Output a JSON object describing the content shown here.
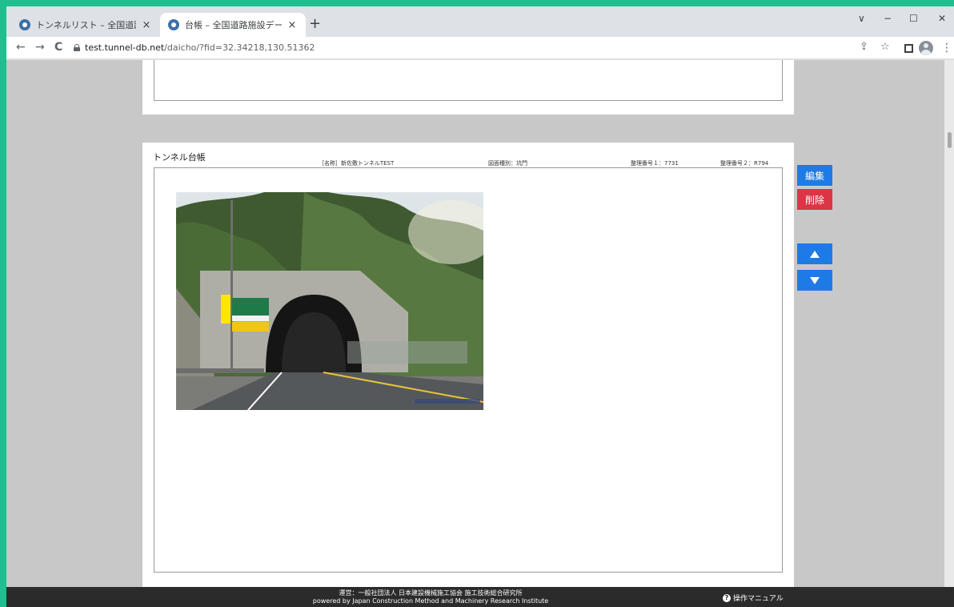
{
  "browser": {
    "tabs": [
      {
        "title": "トンネルリスト – 全国道路施設データ",
        "close": "×"
      },
      {
        "title": "台帳 – 全国道路施設データベース",
        "close": "×"
      }
    ],
    "new_tab": "+",
    "window_controls": {
      "dropdown": "∨",
      "minimize": "−",
      "maximize": "☐",
      "close": "✕"
    },
    "url": {
      "host": "test.tunnel-db.net",
      "path": "/daicho/?fid=32.34218,130.51362"
    },
    "nav": {
      "back": "←",
      "forward": "→",
      "reload": "C"
    },
    "toolbar_icons": {
      "share": "⇪",
      "bookmark": "☆",
      "menu": "⋮"
    }
  },
  "ledger": {
    "title": "トンネル台帳",
    "name_label": "［名称］新佐敷トンネルTEST",
    "drawing_type": "図面種別：坑門",
    "ref_no_1": "整理番号１：7731",
    "ref_no_2": "整理番号２：R794"
  },
  "actions": {
    "edit": "編集",
    "delete": "削除",
    "up_icon": "triangle-up-icon",
    "down_icon": "triangle-down-icon"
  },
  "footer": {
    "operator": "運営：一般社団法人 日本建設機械施工協会 施工技術総合研究所",
    "powered_by": "powered by Japan Construction Method and Machinery Research Institute",
    "manual": "操作マニュアル",
    "help_icon": "?"
  },
  "colors": {
    "primary": "#1e7be5",
    "danger": "#dc3545",
    "window_border": "#1fbf8f",
    "footer_bg": "#2b2b2b"
  }
}
